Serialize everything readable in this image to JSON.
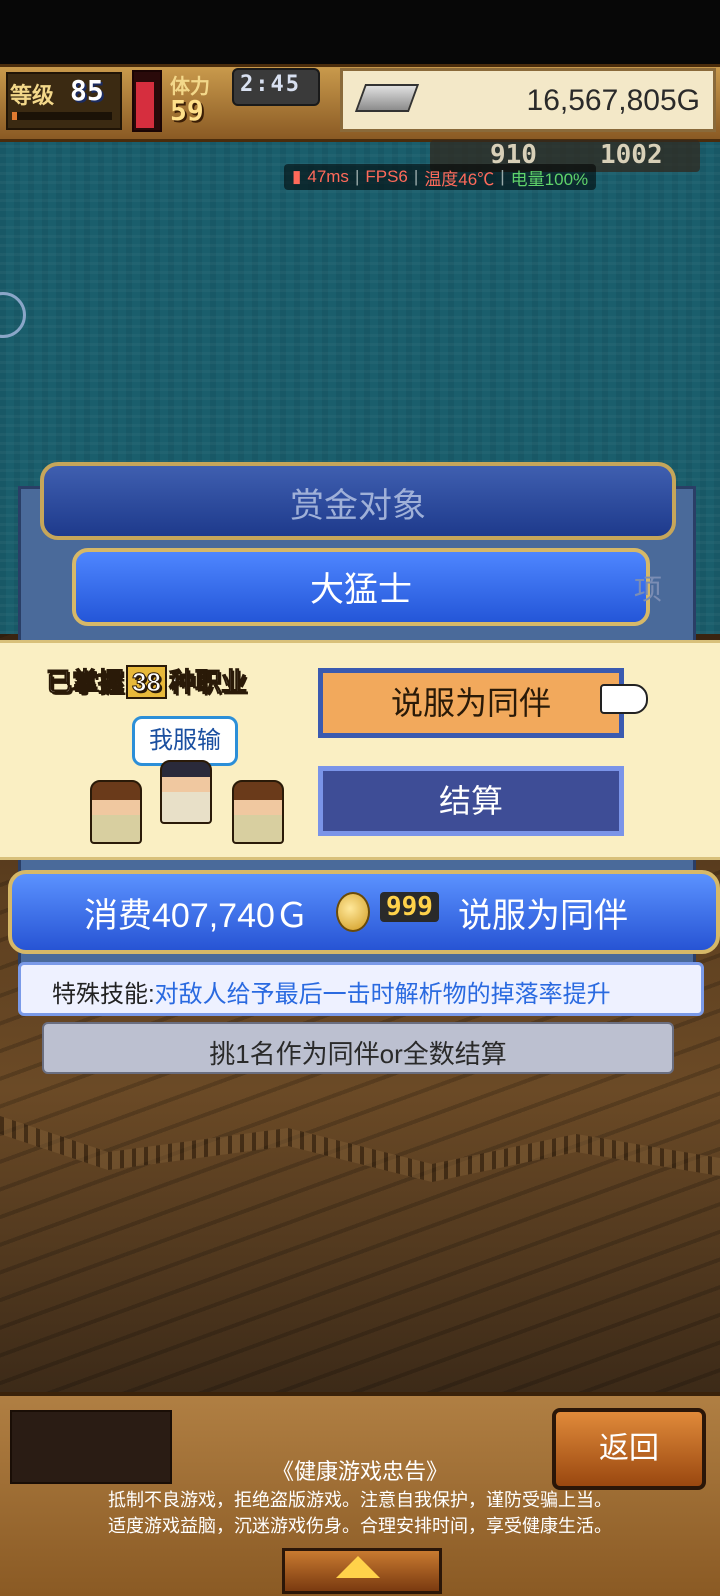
{
  "hud": {
    "level_label": "等级",
    "level": "85",
    "exp_fraction": 0.05,
    "hp_fraction": 0.85,
    "stamina_label": "体力",
    "stamina": "59",
    "time": "2:45",
    "gold": "16,567,805G",
    "resource_a": "910",
    "resource_b": "1002"
  },
  "perf": {
    "ping": "47ms",
    "fps": "FPS6",
    "temp": "温度46℃",
    "battery": "电量100%"
  },
  "panel": {
    "title": "赏金对象",
    "name": "大猛士",
    "side_char": "项"
  },
  "dialog": {
    "mastered_prefix": "已掌握",
    "mastered_count": "38",
    "mastered_suffix": "种职业",
    "bubble": "我服输",
    "persuade_button": "说服为同伴",
    "settle_button": "结算"
  },
  "cost": {
    "text": "消费407,740Ｇ",
    "coins": "999",
    "action": "说服为同伴"
  },
  "skill": {
    "label": "特殊技能:",
    "desc": "对敌人给予最后一击时解析物的掉落率提升"
  },
  "hint": "挑1名作为同伴or全数结算",
  "bottom": {
    "return_button": "返回",
    "notice_title": "《健康游戏忠告》",
    "notice_line1": "抵制不良游戏，拒绝盗版游戏。注意自我保护，谨防受骗上当。",
    "notice_line2": "适度游戏益脑，沉迷游戏伤身。合理安排时间，享受健康生活。"
  },
  "colors": {
    "accent_blue": "#2754d4",
    "gold_border": "#d6b868",
    "persuade_orange": "#f2a95c",
    "perf_green": "#5fd36a",
    "perf_red": "#ff6a5a"
  }
}
